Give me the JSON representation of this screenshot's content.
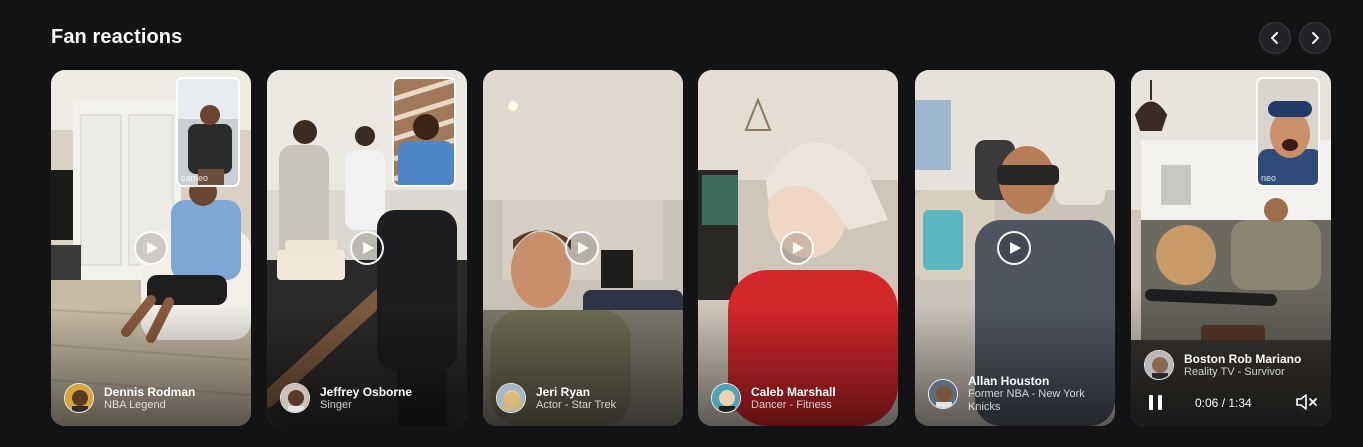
{
  "section": {
    "title": "Fan reactions"
  },
  "nav": {
    "prev_icon": "chevron-left-icon",
    "next_icon": "chevron-right-icon"
  },
  "cards": [
    {
      "name": "Dennis Rodman",
      "role": "NBA Legend",
      "inset_label": "cameo"
    },
    {
      "name": "Jeffrey Osborne",
      "role": "Singer"
    },
    {
      "name": "Jeri Ryan",
      "role": "Actor - Star Trek"
    },
    {
      "name": "Caleb Marshall",
      "role": "Dancer - Fitness"
    },
    {
      "name": "Allan Houston",
      "role": "Former NBA - New York Knicks"
    },
    {
      "name": "Boston Rob Mariano",
      "role": "Reality TV - Survivor",
      "inset_label": "neo",
      "player": {
        "time": "0:06 / 1:34",
        "pause_icon": "pause-icon",
        "mute_icon": "mute-icon"
      }
    }
  ]
}
